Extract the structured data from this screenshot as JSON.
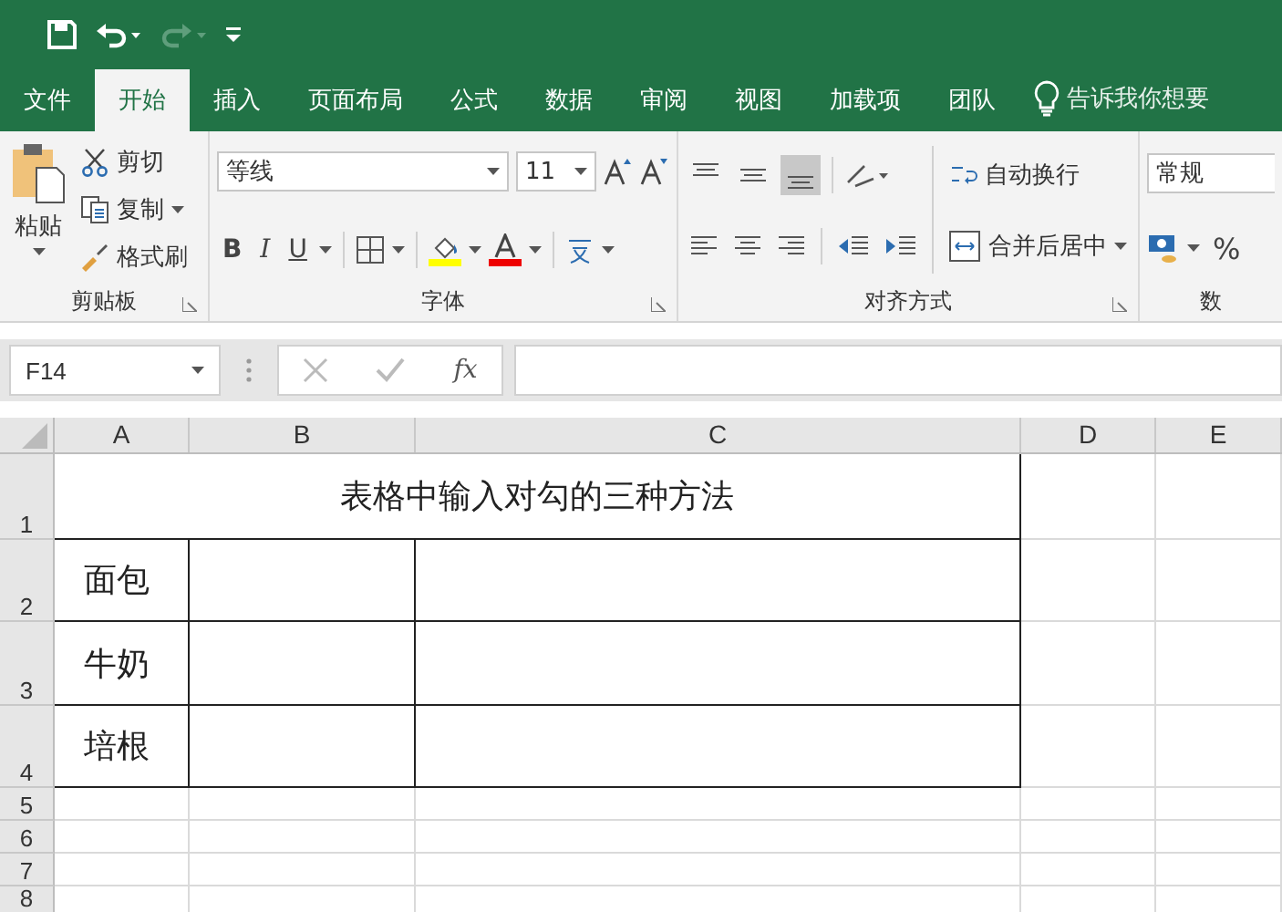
{
  "tabs": [
    {
      "label": "文件",
      "selected": false
    },
    {
      "label": "开始",
      "selected": true
    },
    {
      "label": "插入",
      "selected": false
    },
    {
      "label": "页面布局",
      "selected": false
    },
    {
      "label": "公式",
      "selected": false
    },
    {
      "label": "数据",
      "selected": false
    },
    {
      "label": "审阅",
      "selected": false
    },
    {
      "label": "视图",
      "selected": false
    },
    {
      "label": "加载项",
      "selected": false
    },
    {
      "label": "团队",
      "selected": false
    }
  ],
  "tell_me": "告诉我你想要",
  "clipboard": {
    "paste": "粘贴",
    "cut": "剪切",
    "copy": "复制",
    "format_painter": "格式刷",
    "title": "剪贴板"
  },
  "font": {
    "font_name": "等线",
    "font_size": "11",
    "bold": "B",
    "italic": "I",
    "underline": "U",
    "title": "字体"
  },
  "alignment": {
    "vertical": [
      {
        "selected": false
      },
      {
        "selected": false
      },
      {
        "selected": true
      }
    ],
    "wrap_text": "自动换行",
    "merge_center": "合并后居中",
    "title": "对齐方式"
  },
  "number": {
    "format": "常规",
    "percent": "%",
    "title": "数"
  },
  "formula_bar": {
    "name_box": "F14",
    "fx": "fx"
  },
  "sheet": {
    "columns": [
      "A",
      "B",
      "C",
      "D",
      "E"
    ],
    "rows": [
      {
        "number": "1",
        "title": "表格中输入对勾的三种方法",
        "bordered": true
      },
      {
        "number": "2",
        "label": "面包",
        "bordered": true
      },
      {
        "number": "3",
        "label": "牛奶",
        "bordered": true
      },
      {
        "number": "4",
        "label": "培根",
        "bordered": true
      },
      {
        "number": "5",
        "bordered": false
      },
      {
        "number": "6",
        "bordered": false
      },
      {
        "number": "7",
        "bordered": false
      },
      {
        "number": "8",
        "bordered": false
      }
    ]
  }
}
